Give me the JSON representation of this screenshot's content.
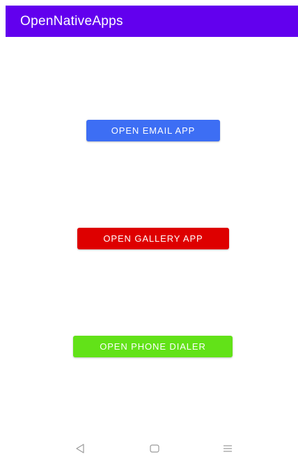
{
  "app_bar": {
    "title": "OpenNativeApps",
    "color": "#6200ee"
  },
  "buttons": {
    "email": {
      "label": "OPEN EMAIL APP",
      "color": "#3d6ef4"
    },
    "gallery": {
      "label": "OPEN GALLERY APP",
      "color": "#de0000"
    },
    "dialer": {
      "label": "OPEN PHONE DIALER",
      "color": "#62e218"
    }
  },
  "nav_bar": {
    "icons": [
      "back-triangle-icon",
      "home-square-icon",
      "menu-lines-icon"
    ],
    "icon_color": "#9a9a9a"
  }
}
